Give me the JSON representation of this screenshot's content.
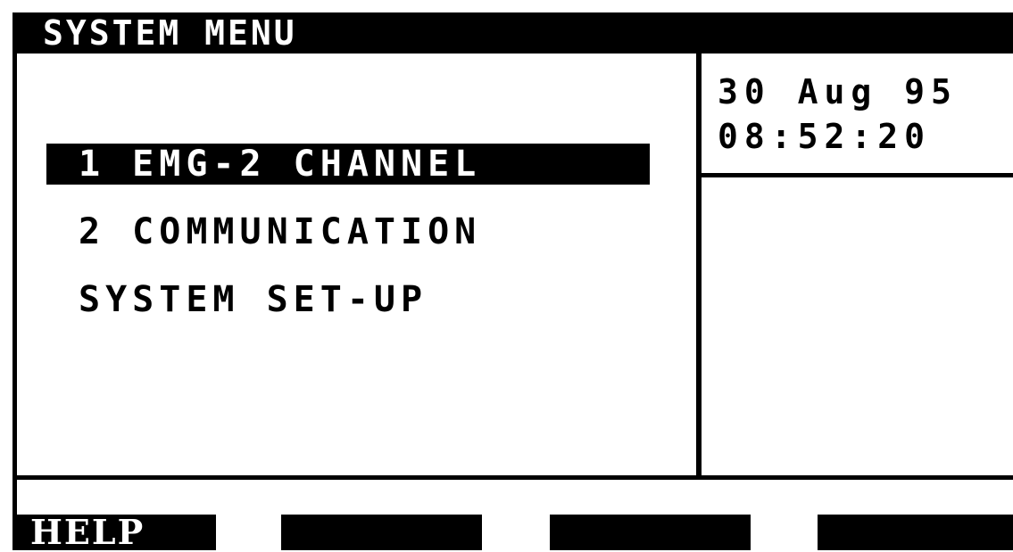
{
  "header": {
    "title": "SYSTEM MENU"
  },
  "menu": {
    "items": [
      {
        "label": "1 EMG-2 CHANNEL",
        "selected": true
      },
      {
        "label": "2 COMMUNICATION",
        "selected": false
      },
      {
        "label": "SYSTEM SET-UP",
        "selected": false
      }
    ]
  },
  "clock": {
    "date": "30 Aug 95",
    "time": "08:52:20"
  },
  "softkeys": [
    {
      "label": "HELP"
    },
    {
      "label": ""
    },
    {
      "label": ""
    },
    {
      "label": ""
    }
  ],
  "colors": {
    "foreground": "#000000",
    "background": "#ffffff"
  }
}
